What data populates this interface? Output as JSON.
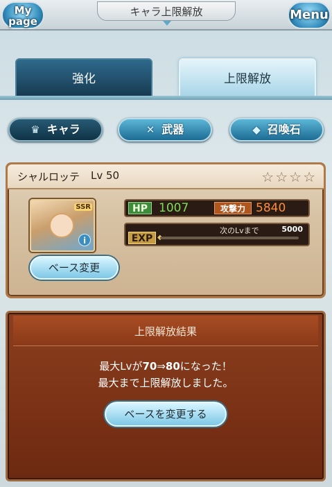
{
  "header": {
    "title": "キャラ上限解放",
    "mypage_line1": "My",
    "mypage_line2": "page",
    "menu_label": "Menu"
  },
  "tabs": [
    {
      "label": "強化",
      "active": false
    },
    {
      "label": "上限解放",
      "active": true
    }
  ],
  "categories": [
    {
      "label": "キャラ",
      "icon": "chara-icon",
      "active": true
    },
    {
      "label": "武器",
      "icon": "sword-icon",
      "active": false
    },
    {
      "label": "召喚石",
      "icon": "summon-crystal-icon",
      "active": false
    }
  ],
  "character": {
    "name": "シャルロッテ",
    "level": "Lv 50",
    "stars": "☆☆☆☆",
    "rarity": "SSR",
    "hp_label": "HP",
    "hp": "1007",
    "atk_label": "攻撃力",
    "atk": "5840",
    "exp_label": "EXP",
    "exp_next_label": "次のLvまで",
    "exp_next_value": "5000",
    "exp_progress": 0,
    "base_change_label": "ベース変更"
  },
  "result": {
    "title": "上限解放結果",
    "line1_prefix": "最大Lvが",
    "line1_from": "70",
    "line1_arrow": "⇒",
    "line1_to": "80",
    "line1_suffix": "になった！",
    "line2": "最大まで上限解放しました。",
    "button_label": "ベースを変更する"
  }
}
